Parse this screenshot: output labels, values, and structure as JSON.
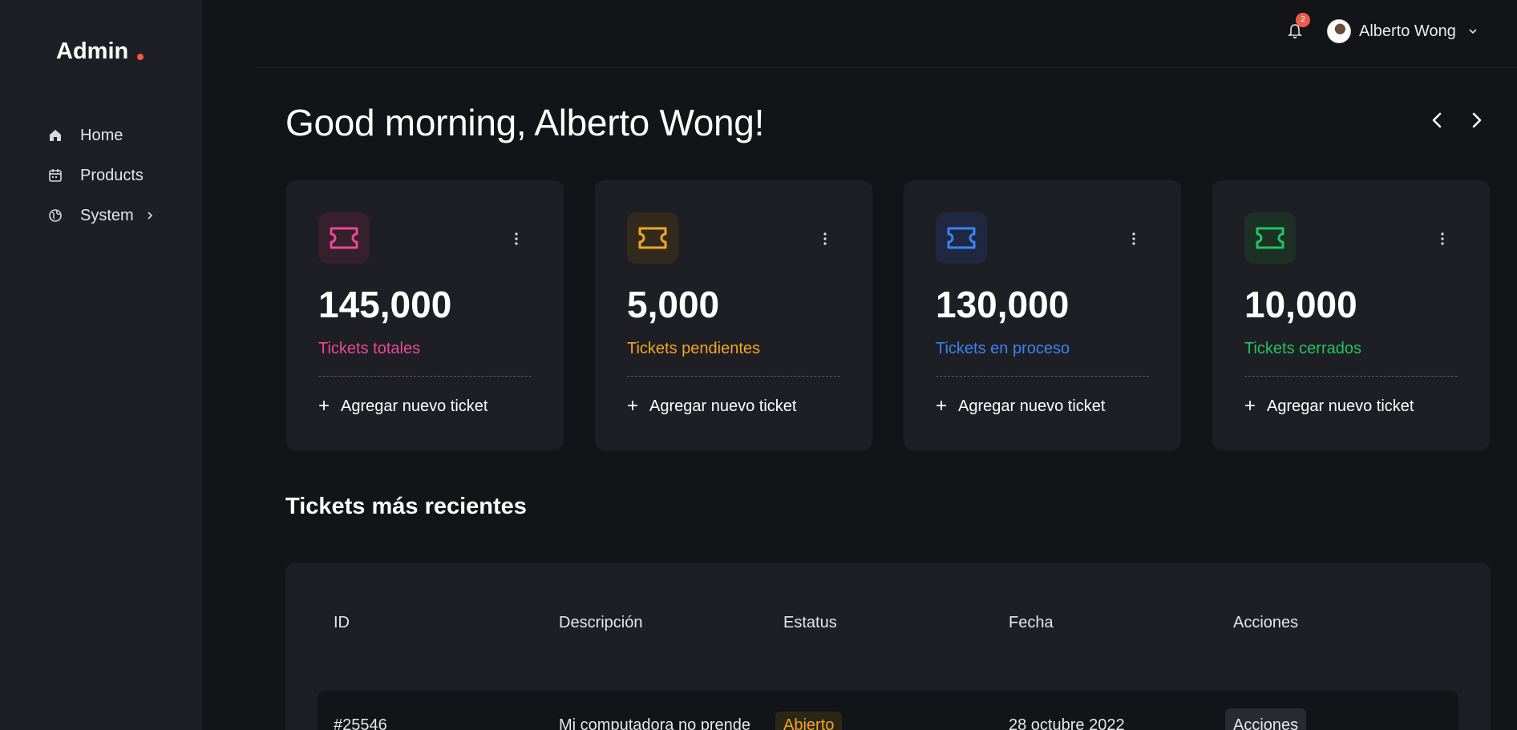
{
  "sidebar": {
    "logo": "Admin",
    "items": [
      {
        "label": "Home",
        "icon": "home-icon"
      },
      {
        "label": "Products",
        "icon": "calendar-icon"
      },
      {
        "label": "System",
        "icon": "globe-icon"
      }
    ]
  },
  "header": {
    "notification_count": "2",
    "user_name": "Alberto Wong"
  },
  "main": {
    "greeting": "Good morning, Alberto Wong!",
    "cards": [
      {
        "value": "145,000",
        "label": "Tickets totales",
        "action": "Agregar nuevo ticket",
        "color": "#ec4899"
      },
      {
        "value": "5,000",
        "label": "Tickets pendientes",
        "action": "Agregar nuevo ticket",
        "color": "#f4a524"
      },
      {
        "value": "130,000",
        "label": "Tickets en proceso",
        "action": "Agregar nuevo ticket",
        "color": "#3b82f6"
      },
      {
        "value": "10,000",
        "label": "Tickets cerrados",
        "action": "Agregar nuevo ticket",
        "color": "#22c55e"
      }
    ],
    "recent_title": "Tickets más recientes",
    "table": {
      "headers": [
        "ID",
        "Descripción",
        "Estatus",
        "Fecha",
        "Acciones"
      ],
      "rows": [
        {
          "id": "#25546",
          "description": "Mi computadora no prende",
          "status": "Abierto",
          "date": "28 octubre 2022",
          "action": "Acciones"
        }
      ]
    }
  }
}
